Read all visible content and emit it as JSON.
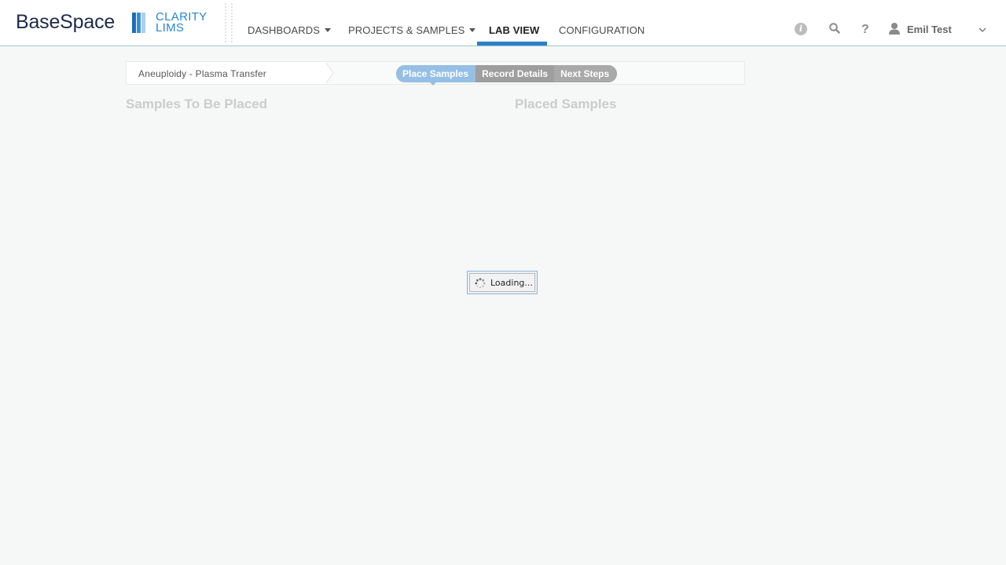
{
  "header": {
    "brand": "BaseSpace",
    "product_line1": "CLARITY",
    "product_line2": "LIMS",
    "nav": [
      {
        "label": "DASHBOARDS",
        "has_caret": true
      },
      {
        "label": "PROJECTS & SAMPLES",
        "has_caret": true
      },
      {
        "label": "LAB VIEW",
        "active": true
      },
      {
        "label": "CONFIGURATION"
      }
    ],
    "icons": [
      "info-icon",
      "search-icon",
      "help-icon",
      "user-icon",
      "chevron-down-icon"
    ],
    "help_glyph": "?",
    "info_glyph": "i",
    "user_name": "Emil Test"
  },
  "stepbar": {
    "protocol": "Aneuploidy - Plasma Transfer",
    "steps": [
      "Place Samples",
      "Record Details",
      "Next Steps"
    ],
    "active_step": "Place Samples"
  },
  "sections": {
    "left_title": "Samples To Be Placed",
    "right_title": "Placed Samples"
  },
  "loading": {
    "text": "Loading..."
  },
  "colors": {
    "accent": "#2b7fc9",
    "active_step": "#95bfe6",
    "background": "#f6f7f7"
  }
}
